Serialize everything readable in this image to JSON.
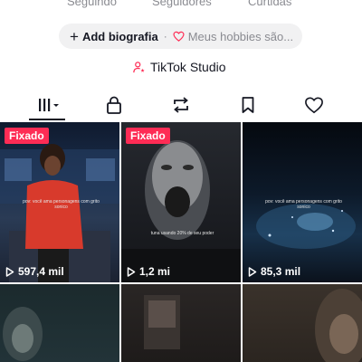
{
  "stats": {
    "following": "Seguindo",
    "followers": "Seguidores",
    "likes": "Curtidas"
  },
  "bio": {
    "add_label": "Add biografia",
    "separator": "·",
    "hobbies_placeholder": "Meus hobbies são..."
  },
  "studio": {
    "label": "TikTok Studio"
  },
  "tabs": [
    {
      "icon": "videos-grid-icon"
    },
    {
      "icon": "lock-icon"
    },
    {
      "icon": "repost-icon"
    },
    {
      "icon": "bookmark-icon"
    },
    {
      "icon": "heart-icon"
    }
  ],
  "videos": [
    {
      "pinned": "Fixado",
      "views": "597,4 mil",
      "caption": "pov: você ama personagens com grito sonico"
    },
    {
      "pinned": "Fixado",
      "views": "1,2 mi",
      "caption": "tuna usando 20% de seu poder"
    },
    {
      "pinned": "",
      "views": "85,3 mil",
      "caption": "pov: você ama personagens com grito sonico"
    },
    {
      "pinned": "",
      "views": "",
      "caption": ""
    },
    {
      "pinned": "",
      "views": "",
      "caption": ""
    },
    {
      "pinned": "",
      "views": "",
      "caption": ""
    }
  ],
  "colors": {
    "accent": "#fe2c55",
    "text": "#161823",
    "muted": "#8a8b91",
    "pill": "#f1f1f2"
  }
}
